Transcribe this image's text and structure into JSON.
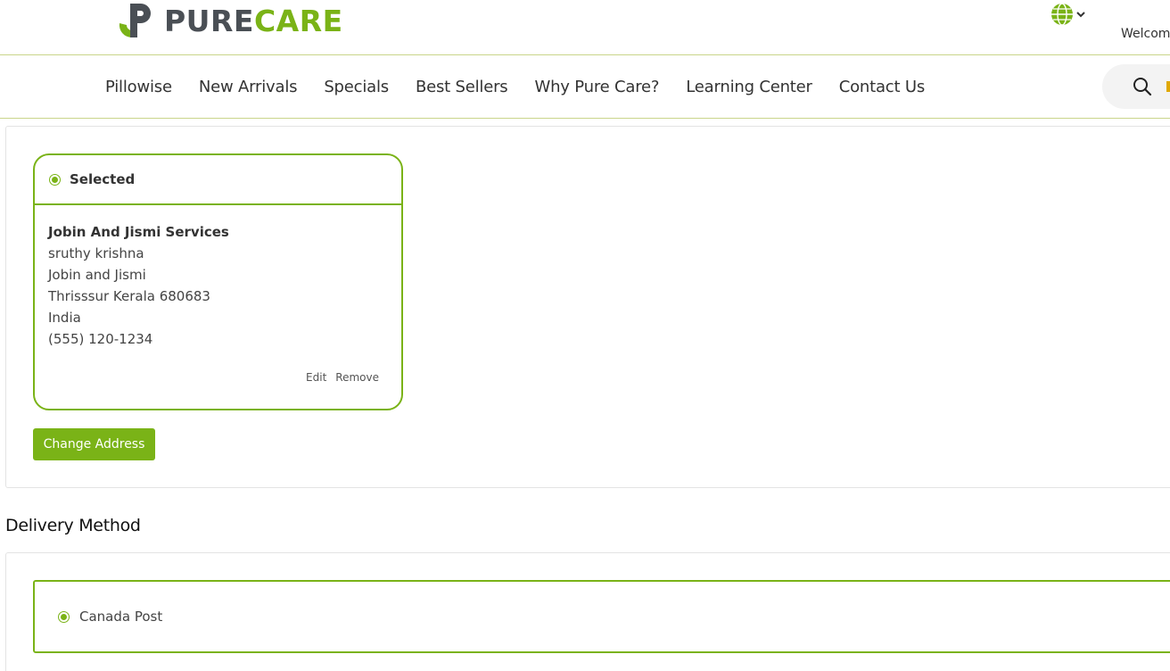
{
  "header": {
    "logo": {
      "text_pure": "PURE",
      "text_care": "CARE",
      "brand_green": "#7ab317",
      "brand_gray": "#4a4f55"
    },
    "language_icon": "globe-icon",
    "welcome_text": "Welcome"
  },
  "nav": {
    "items": [
      "Pillowise",
      "New Arrivals",
      "Specials",
      "Best Sellers",
      "Why Pure Care?",
      "Learning Center",
      "Contact Us"
    ],
    "search_icon": "search-icon"
  },
  "address": {
    "status_label": "Selected",
    "company": "Jobin And Jismi Services",
    "name": "sruthy krishna",
    "line1": "Jobin and Jismi",
    "city_line": "Thrisssur Kerala 680683",
    "country": "India",
    "phone": "(555) 120-1234",
    "edit_label": "Edit",
    "remove_label": "Remove",
    "change_button": "Change Address"
  },
  "delivery": {
    "title": "Delivery Method",
    "option_label": "Canada Post"
  },
  "colors": {
    "accent": "#7ab317",
    "border_light": "#e3e3e3"
  }
}
